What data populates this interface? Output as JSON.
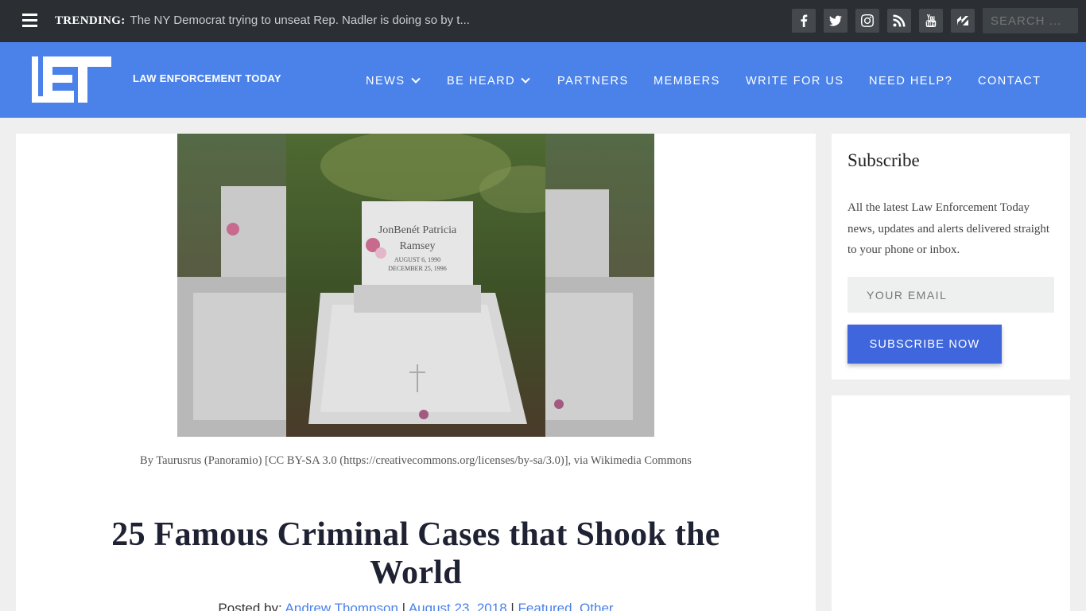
{
  "topbar": {
    "trending_label": "TRENDING:",
    "trending_text": "The NY Democrat trying to unseat Rep. Nadler is doing so by t...",
    "social": [
      "facebook-icon",
      "twitter-icon",
      "instagram-icon",
      "rss-icon",
      "youtube-icon",
      "newsbreak-icon"
    ],
    "search_placeholder": "SEARCH ..."
  },
  "header": {
    "brand": "LAW ENFORCEMENT TODAY",
    "nav": [
      {
        "label": "NEWS"
      },
      {
        "label": "BE HEARD"
      },
      {
        "label": "PARTNERS"
      },
      {
        "label": "MEMBERS"
      },
      {
        "label": "WRITE FOR US"
      },
      {
        "label": "NEED HELP?"
      },
      {
        "label": "CONTACT"
      }
    ]
  },
  "article": {
    "caption": "By Taurusrus (Panoramio) [CC BY-SA 3.0 (https://creativecommons.org/licenses/by-sa/3.0)], via Wikimedia Commons",
    "title": "25 Famous Criminal Cases that Shook the World",
    "meta": {
      "posted_by": "Posted by:",
      "author": "Andrew Thompson",
      "date": "August 23, 2018",
      "cat1": "Featured",
      "cat2": "Other"
    },
    "image_text": {
      "name1": "JonBenét Patricia",
      "name2": "Ramsey",
      "born": "AUGUST 6, 1990",
      "died": "DECEMBER 25, 1996"
    }
  },
  "sidebar": {
    "title": "Subscribe",
    "text": "All the latest Law Enforcement Today news, updates and alerts delivered straight to your phone or inbox.",
    "email_placeholder": "YOUR EMAIL",
    "button": "SUBSCRIBE NOW"
  },
  "colors": {
    "accent": "#4a82ea",
    "topbar": "#2b2f33",
    "button": "#3f66dc"
  }
}
